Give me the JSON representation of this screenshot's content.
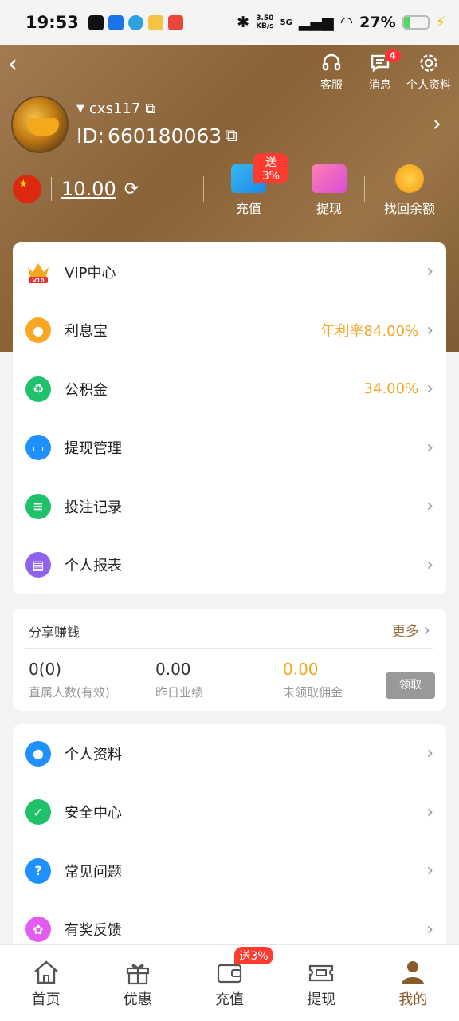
{
  "status_bar": {
    "time": "19:53",
    "speed_value": "3.50",
    "speed_unit": "KB/s",
    "network": "5G",
    "battery": "27%",
    "battery_level": 0.27
  },
  "header": {
    "actions": [
      {
        "label": "客服",
        "icon": "headset-icon"
      },
      {
        "label": "消息",
        "icon": "message-icon",
        "badge": "4"
      },
      {
        "label": "个人资料",
        "icon": "gear-icon"
      }
    ],
    "username": "cxs117",
    "id_label": "ID:",
    "id_value": "660180063"
  },
  "wallet": {
    "balance": "10.00",
    "actions": [
      {
        "label": "充值",
        "tag": "送3%"
      },
      {
        "label": "提现"
      },
      {
        "label": "找回余额"
      }
    ]
  },
  "menu1": [
    {
      "label": "VIP中心",
      "icon": "vip-crown-icon",
      "value": ""
    },
    {
      "label": "利息宝",
      "icon": "piggy-bank-icon",
      "value": "年利率84.00%"
    },
    {
      "label": "公积金",
      "icon": "fund-icon",
      "value": "34.00%"
    },
    {
      "label": "提现管理",
      "icon": "wallet-icon",
      "value": ""
    },
    {
      "label": "投注记录",
      "icon": "record-icon",
      "value": ""
    },
    {
      "label": "个人报表",
      "icon": "report-icon",
      "value": ""
    }
  ],
  "vip_level": "V10",
  "share": {
    "title": "分享赚钱",
    "more": "更多",
    "stats": [
      {
        "value": "0(0)",
        "label": "直属人数(有效)"
      },
      {
        "value": "0.00",
        "label": "昨日业绩"
      },
      {
        "value": "0.00",
        "label": "未领取佣金"
      }
    ],
    "claim": "领取"
  },
  "menu2": [
    {
      "label": "个人资料",
      "icon": "user-icon"
    },
    {
      "label": "安全中心",
      "icon": "shield-icon"
    },
    {
      "label": "常见问题",
      "icon": "question-icon"
    },
    {
      "label": "有奖反馈",
      "icon": "gift-icon"
    }
  ],
  "tabbar": [
    {
      "label": "首页",
      "icon": "home-icon"
    },
    {
      "label": "优惠",
      "icon": "gift-box-icon"
    },
    {
      "label": "充值",
      "icon": "wallet-tab-icon",
      "tag": "送3%"
    },
    {
      "label": "提现",
      "icon": "withdraw-icon"
    },
    {
      "label": "我的",
      "icon": "profile-icon",
      "active": true
    }
  ],
  "colors": {
    "header_brown": "#8a6238",
    "accent_gold": "#f5a623",
    "active_tab": "#8b5a2b",
    "badge_red": "#ff3b2f"
  }
}
